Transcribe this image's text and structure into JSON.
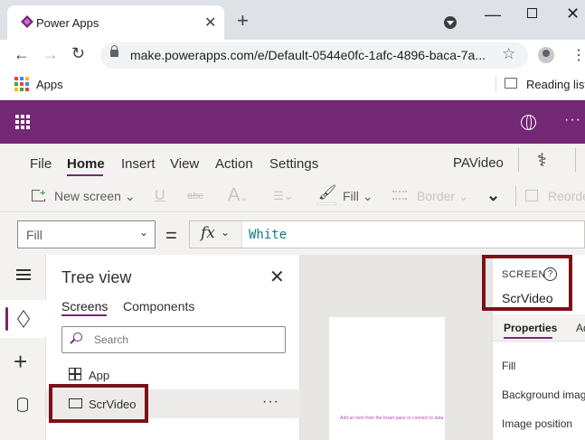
{
  "browser": {
    "tab_title": "Power Apps",
    "url": "make.powerapps.com/e/Default-0544e0fc-1afc-4896-baca-7a...",
    "bookmarks": {
      "apps_label": "Apps",
      "reading_list": "Reading list"
    }
  },
  "menu": {
    "items": [
      "File",
      "Home",
      "Insert",
      "View",
      "Action",
      "Settings"
    ],
    "active": "Home",
    "app_name": "PAVideo"
  },
  "ribbon": {
    "new_screen": "New screen",
    "fill": "Fill",
    "border": "Border",
    "reorder": "Reorde"
  },
  "formula_bar": {
    "property": "Fill",
    "equals": "=",
    "fx": "fx",
    "formula": "White"
  },
  "tree_view": {
    "title": "Tree view",
    "tabs": [
      "Screens",
      "Components"
    ],
    "active_tab": "Screens",
    "search_placeholder": "Search",
    "items": [
      {
        "label": "App"
      },
      {
        "label": "ScrVideo",
        "selected": true
      }
    ]
  },
  "canvas": {
    "placeholder_text": "Add an item from the Insert pane or connect to data"
  },
  "properties_panel": {
    "type_label": "SCREEN",
    "screen_name": "ScrVideo",
    "tabs": [
      "Properties",
      "Ad"
    ],
    "active_tab": "Properties",
    "rows": [
      "Fill",
      "Background image",
      "Image position"
    ]
  },
  "colors": {
    "brand_purple": "#742774",
    "highlight_red": "#7a1218",
    "formula_teal": "#0f7c80"
  }
}
